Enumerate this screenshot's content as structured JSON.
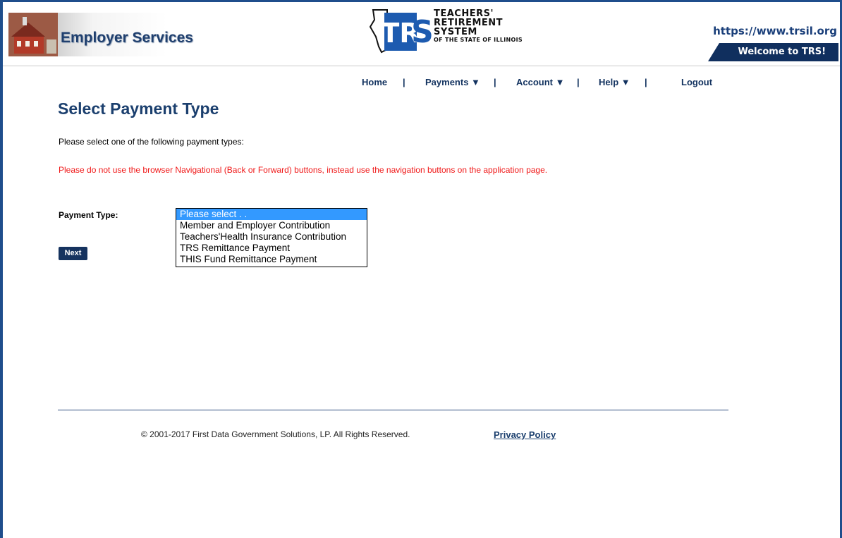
{
  "header": {
    "brand_title": "Employer Services",
    "logo": {
      "line1": "TEACHERS'",
      "line2": "RETIREMENT",
      "line3": "SYSTEM",
      "line4": "OF THE STATE OF ILLINOIS"
    },
    "site_url": "https://www.trsil.org",
    "welcome": "Welcome to TRS!"
  },
  "nav": {
    "home": "Home",
    "payments": "Payments ▼",
    "account": "Account ▼",
    "help": "Help ▼",
    "logout": "Logout",
    "separator": "|"
  },
  "main": {
    "title": "Select Payment Type",
    "instruction": "Please select one of the following payment types:",
    "warning": "Please do not use the browser Navigational (Back or Forward) buttons, instead use the navigation buttons on the application page.",
    "payment_type_label": "Payment Type:",
    "options": [
      "Please select . .",
      "Member and Employer Contribution",
      "Teachers'Health Insurance Contribution",
      "TRS Remittance Payment",
      "THIS Fund Remittance Payment"
    ],
    "selected_index": 0,
    "next_label": "Next"
  },
  "footer": {
    "copyright": "© 2001-2017 First Data Government Solutions, LP. All Rights Reserved.",
    "privacy": "Privacy Policy"
  },
  "colors": {
    "frame": "#1f4e8c",
    "brand_blue": "#1b3f6e",
    "nav_dark": "#102f5e",
    "warning_red": "#f01818",
    "selection": "#3399ff"
  }
}
